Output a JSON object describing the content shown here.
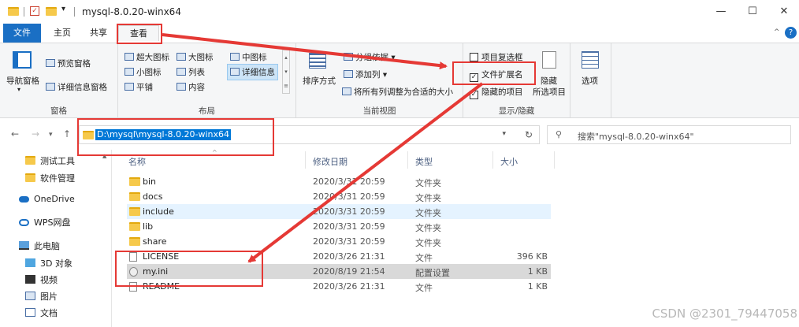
{
  "window": {
    "title": "mysql-8.0.20-winx64",
    "minimize_glyph": "—",
    "maximize_glyph": "☐",
    "close_glyph": "✕"
  },
  "tabs": [
    {
      "label": "文件"
    },
    {
      "label": "主页"
    },
    {
      "label": "共享"
    },
    {
      "label": "查看"
    }
  ],
  "ribbon": {
    "panes": {
      "nav_pane": "导航窗格",
      "preview_pane": "预览窗格",
      "details_pane": "详细信息窗格",
      "label": "窗格"
    },
    "layout": {
      "items": [
        "超大图标",
        "大图标",
        "中图标",
        "小图标",
        "列表",
        "详细信息",
        "平铺",
        "内容"
      ],
      "label": "布局"
    },
    "current_view": {
      "sort_by": "排序方式",
      "group_by": "分组依据",
      "add_column": "添加列",
      "fit_columns": "将所有列调整为合适的大小",
      "label": "当前视图"
    },
    "show_hide": {
      "item_checkboxes": "项目复选框",
      "file_extensions": "文件扩展名",
      "hidden_items": "隐藏的项目",
      "hide_selected": "隐藏",
      "hide_selected_sub": "所选项目",
      "label": "显示/隐藏"
    },
    "options": "选项"
  },
  "address": {
    "path": "D:\\mysql\\mysql-8.0.20-winx64",
    "search_placeholder": "搜索\"mysql-8.0.20-winx64\""
  },
  "sidebar": {
    "items": [
      "测试工具",
      "软件管理",
      "OneDrive",
      "WPS网盘",
      "此电脑",
      "3D 对象",
      "视频",
      "图片",
      "文档"
    ]
  },
  "columns": {
    "name": "名称",
    "modified": "修改日期",
    "type": "类型",
    "size": "大小"
  },
  "files": [
    {
      "name": "bin",
      "modified": "2020/3/31 20:59",
      "type": "文件夹",
      "size": ""
    },
    {
      "name": "docs",
      "modified": "2020/3/31 20:59",
      "type": "文件夹",
      "size": ""
    },
    {
      "name": "include",
      "modified": "2020/3/31 20:59",
      "type": "文件夹",
      "size": ""
    },
    {
      "name": "lib",
      "modified": "2020/3/31 20:59",
      "type": "文件夹",
      "size": ""
    },
    {
      "name": "share",
      "modified": "2020/3/31 20:59",
      "type": "文件夹",
      "size": ""
    },
    {
      "name": "LICENSE",
      "modified": "2020/3/26 21:31",
      "type": "文件",
      "size": "396 KB"
    },
    {
      "name": "my.ini",
      "modified": "2020/8/19 21:54",
      "type": "配置设置",
      "size": "1 KB"
    },
    {
      "name": "README",
      "modified": "2020/3/26 21:31",
      "type": "文件",
      "size": "1 KB"
    }
  ],
  "watermark": "CSDN @2301_79447058",
  "colors": {
    "accent": "#1a6fc4",
    "annotation": "#e53935",
    "folder": "#f6c94b"
  }
}
